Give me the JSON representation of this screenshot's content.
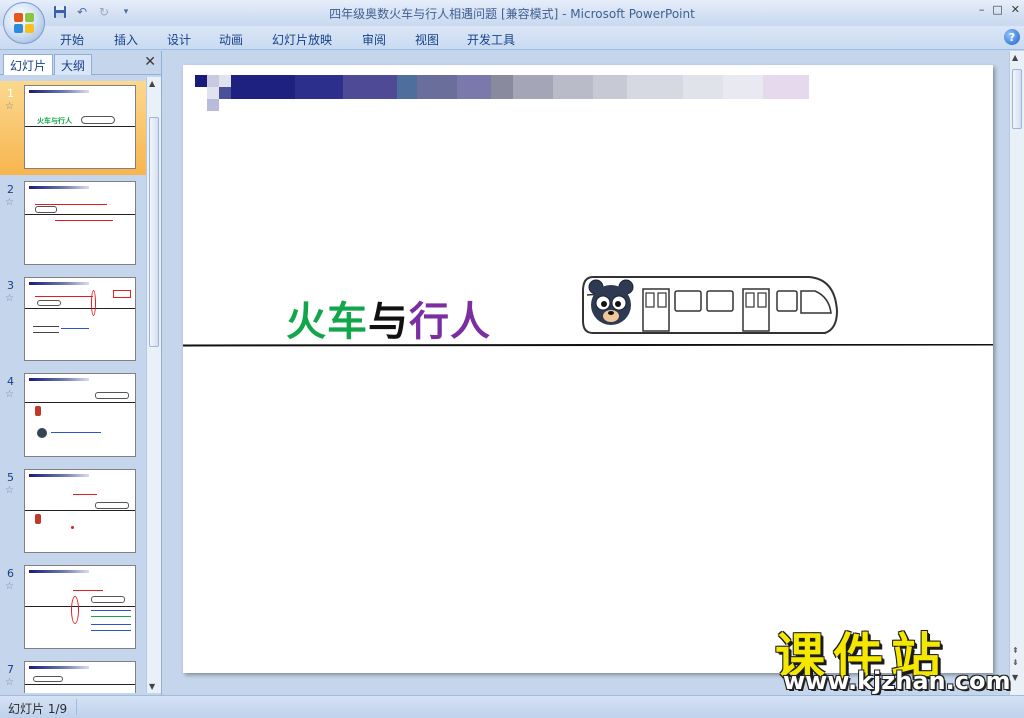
{
  "window": {
    "title": "四年级奥数火车与行人相遇问题 [兼容模式] - Microsoft PowerPoint",
    "minimize": "–",
    "restore": "□",
    "close": "✕"
  },
  "quick_access": {
    "undo_icon": "↶",
    "redo_icon": "↻",
    "dropdown_icon": "▾"
  },
  "menu": {
    "items": [
      "开始",
      "插入",
      "设计",
      "动画",
      "幻灯片放映",
      "审阅",
      "视图",
      "开发工具"
    ],
    "help": "?"
  },
  "left_pane": {
    "tabs": [
      "幻灯片",
      "大纲"
    ],
    "close": "✕",
    "selected_index": 0,
    "thumbnails": [
      {
        "num": "1",
        "title": "火车与行人"
      },
      {
        "num": "2"
      },
      {
        "num": "3"
      },
      {
        "num": "4"
      },
      {
        "num": "5"
      },
      {
        "num": "6"
      },
      {
        "num": "7"
      }
    ]
  },
  "slide": {
    "title_part1": "火车",
    "title_part2": "与",
    "title_part3": "行人",
    "colors": {
      "title_green": "#12a64a",
      "title_black": "#111111",
      "title_purple": "#7a2ea0"
    }
  },
  "status": {
    "slide_info": "幻灯片 1/9"
  },
  "watermark": {
    "main": "课件站",
    "url": "www.kjzhan.com"
  }
}
